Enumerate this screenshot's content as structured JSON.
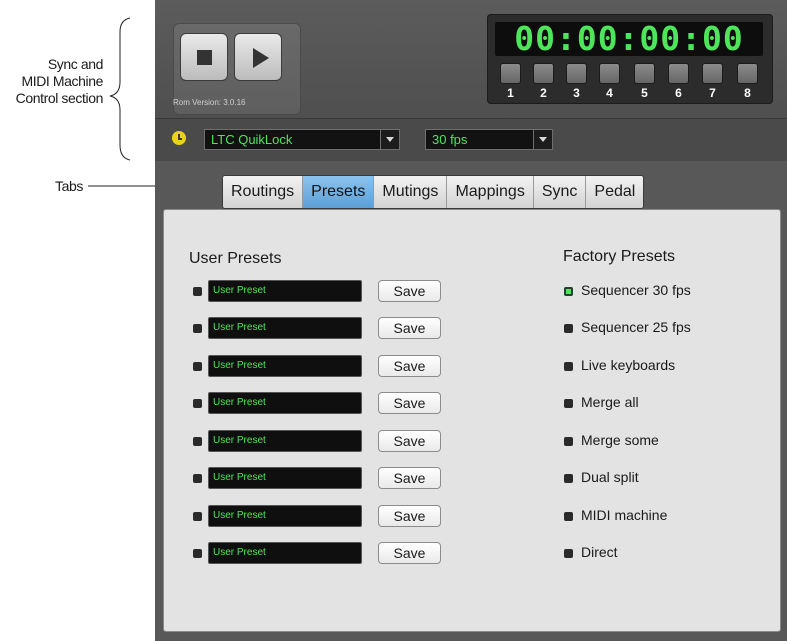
{
  "annotations": {
    "sync_section": [
      "Sync and",
      "MIDI Machine",
      "Control section"
    ],
    "tabs": "Tabs"
  },
  "transport": {
    "stop": "stop-icon",
    "play": "play-icon",
    "rom_version": "Rom Version: 3.0.16"
  },
  "timecode": {
    "display": "00:00:00:00",
    "mmc_buttons": [
      "1",
      "2",
      "3",
      "4",
      "5",
      "6",
      "7",
      "8"
    ]
  },
  "sync": {
    "source": "LTC QuikLock",
    "frame_rate": "30 fps"
  },
  "tabs": [
    {
      "label": "Routings",
      "active": false
    },
    {
      "label": "Presets",
      "active": true
    },
    {
      "label": "Mutings",
      "active": false
    },
    {
      "label": "Mappings",
      "active": false
    },
    {
      "label": "Sync",
      "active": false
    },
    {
      "label": "Pedal",
      "active": false
    }
  ],
  "user_presets": {
    "title": "User Presets",
    "save_label": "Save",
    "items": [
      "User Preset",
      "User Preset",
      "User Preset",
      "User Preset",
      "User Preset",
      "User Preset",
      "User Preset",
      "User Preset"
    ]
  },
  "factory_presets": {
    "title": "Factory Presets",
    "items": [
      {
        "label": "Sequencer 30 fps",
        "selected": true
      },
      {
        "label": "Sequencer 25 fps",
        "selected": false
      },
      {
        "label": "Live keyboards",
        "selected": false
      },
      {
        "label": "Merge all",
        "selected": false
      },
      {
        "label": "Merge some",
        "selected": false
      },
      {
        "label": "Dual split",
        "selected": false
      },
      {
        "label": "MIDI machine",
        "selected": false
      },
      {
        "label": "Direct",
        "selected": false
      }
    ]
  },
  "colors": {
    "lcd_green": "#4de65a",
    "active_tab": "#6fb0e4",
    "panel": "#585858"
  }
}
